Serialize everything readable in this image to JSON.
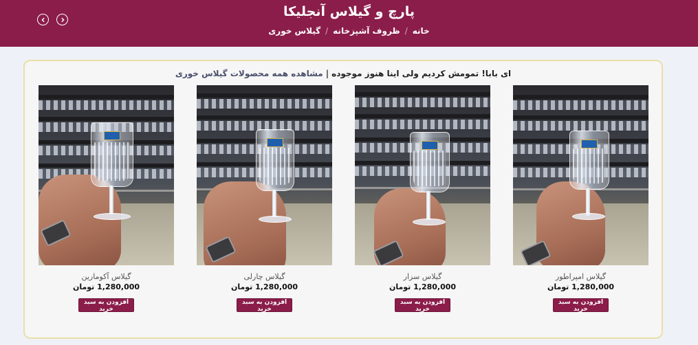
{
  "header": {
    "title": "پارچ و گیلاس آنجلیکا",
    "breadcrumb": [
      "خانه",
      "ظروف آشپزخانه",
      "گیلاس خوری"
    ],
    "separator": "/",
    "bg_color": "#8b1d4a"
  },
  "nav": {
    "prev_icon": "chevron-left-icon",
    "next_icon": "chevron-right-icon"
  },
  "notice": {
    "text": "ای بابا! تمومش کردیم ولی اینا هنوز موجوده",
    "divider": "|",
    "link": "مشاهده همه محصولات گیلاس خوری"
  },
  "products": [
    {
      "name": "گیلاس امپراطور",
      "price": "1,280,000 تومان",
      "button": "افزودن به سبد خرید"
    },
    {
      "name": "گیلاس سزار",
      "price": "1,280,000 تومان",
      "button": "افزودن به سبد خرید"
    },
    {
      "name": "گیلاس چارلی",
      "price": "1,280,000 تومان",
      "button": "افزودن به سبد خرید"
    },
    {
      "name": "گیلاس آکومارین",
      "price": "1,280,000 تومان",
      "button": "افزودن به سبد خرید"
    }
  ],
  "colors": {
    "accent": "#8b1d4a",
    "panel_border": "#e9dfa6",
    "page_bg": "#eef2f8"
  }
}
